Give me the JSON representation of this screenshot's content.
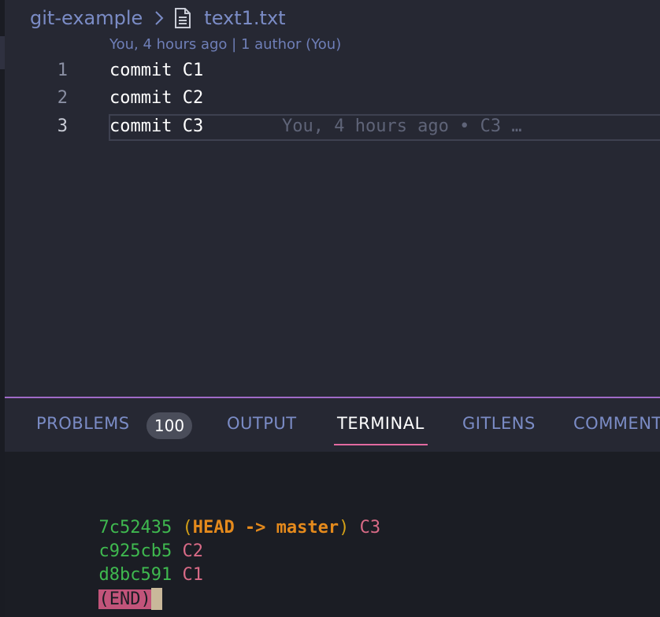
{
  "breadcrumb": {
    "folder": "git-example",
    "separator_icon": "chevron-right-icon",
    "file_icon": "file-text-icon",
    "file": "text1.txt"
  },
  "codelens": "You, 4 hours ago | 1 author (You)",
  "editor": {
    "lines": [
      {
        "number": "1",
        "text": "commit C1"
      },
      {
        "number": "2",
        "text": "commit C2"
      },
      {
        "number": "3",
        "text": "commit C3"
      }
    ],
    "inline_blame": "You, 4 hours ago • C3 …"
  },
  "panel": {
    "tabs": [
      {
        "label": "PROBLEMS",
        "badge": "100"
      },
      {
        "label": "OUTPUT"
      },
      {
        "label": "TERMINAL",
        "active": true
      },
      {
        "label": "GITLENS"
      },
      {
        "label": "COMMENT"
      }
    ]
  },
  "terminal": {
    "lines": [
      {
        "hash": "7c52435",
        "open": "(",
        "ref": "HEAD -> master",
        "close": ")",
        "msg": "C3"
      },
      {
        "hash": "c925cb5",
        "msg": "C2"
      },
      {
        "hash": "d8bc591",
        "msg": "C1"
      }
    ],
    "end": "(END)"
  },
  "colors": {
    "editor_bg": "#262833",
    "terminal_bg": "#1b1d24",
    "accent_tab": "#e26aa0",
    "hash": "#3fb94f",
    "ref": "#e58a1c",
    "message": "#d86a86"
  }
}
